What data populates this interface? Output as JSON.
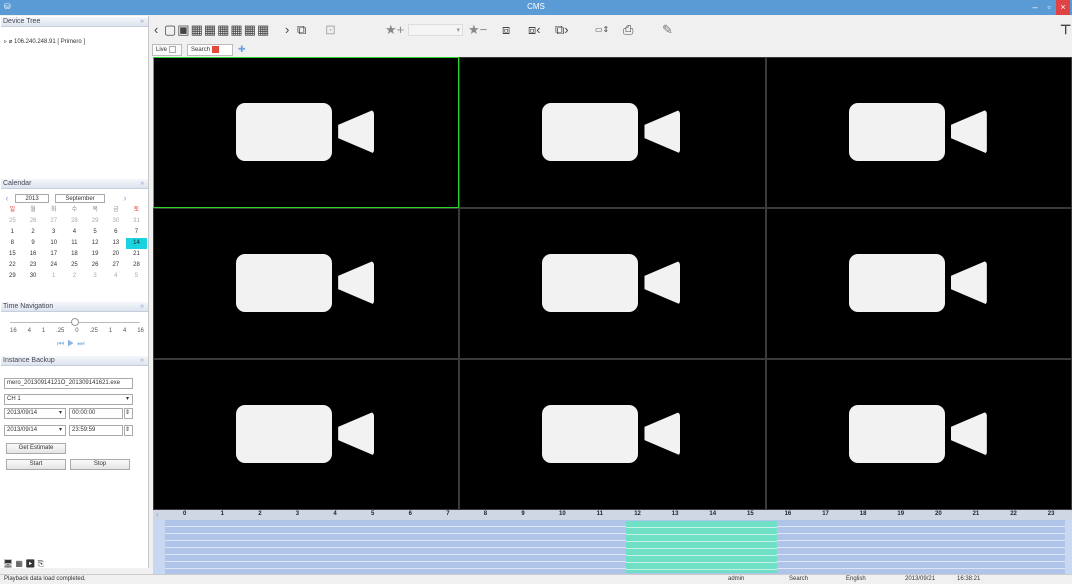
{
  "window": {
    "title": "CMS"
  },
  "device_tree": {
    "header": "Device Tree",
    "items": [
      {
        "label": "106.240.248.91 [ Primero ]"
      }
    ],
    "tools": {
      "add": "add-device-icon",
      "remove": "remove-device-icon",
      "edit": "edit-device-icon"
    }
  },
  "calendar": {
    "header": "Calendar",
    "year": "2013",
    "month": "September",
    "weekdays": [
      "일",
      "월",
      "화",
      "수",
      "목",
      "금",
      "토"
    ],
    "weeks": [
      [
        "25",
        "26",
        "27",
        "28",
        "29",
        "30",
        "31"
      ],
      [
        "1",
        "2",
        "3",
        "4",
        "5",
        "6",
        "7"
      ],
      [
        "8",
        "9",
        "10",
        "11",
        "12",
        "13",
        "14"
      ],
      [
        "15",
        "16",
        "17",
        "18",
        "19",
        "20",
        "21"
      ],
      [
        "22",
        "23",
        "24",
        "25",
        "26",
        "27",
        "28"
      ],
      [
        "29",
        "30",
        "1",
        "2",
        "3",
        "4",
        "5"
      ]
    ],
    "selected": "14"
  },
  "time_navigation": {
    "header": "Time Navigation",
    "labels": [
      "16",
      "4",
      "1",
      ".25",
      "0",
      ".25",
      "1",
      "4",
      "16"
    ],
    "slider_position": 0.5
  },
  "instance_backup": {
    "header": "Instance Backup",
    "filename": "mero_20130914121O_201309141621.exe",
    "channel": "CH 1",
    "start_date": "2013/09/14",
    "start_time": "00:00:00",
    "end_date": "2013/09/14",
    "end_time": "23:59:59",
    "estimate_label": "Get Estimate",
    "start_label": "Start",
    "stop_label": "Stop"
  },
  "tabs": [
    {
      "label": "Live"
    },
    {
      "label": "Search"
    }
  ],
  "timeline": {
    "hours": [
      "0",
      "1",
      "2",
      "3",
      "4",
      "5",
      "6",
      "7",
      "8",
      "9",
      "10",
      "11",
      "12",
      "13",
      "14",
      "15",
      "16",
      "17",
      "18",
      "19",
      "20",
      "21",
      "22",
      "23"
    ],
    "recorded_start_hour": 12,
    "recorded_end_hour": 16
  },
  "status": {
    "message": "Playback data load completed.",
    "user": "admin",
    "mode": "Search",
    "language": "English",
    "date": "2013/09/21",
    "time": "16:38:21"
  },
  "colors": {
    "accent": "#5b9bd5",
    "selected_cell": "#2bd32b",
    "calendar_selected": "#19d3e0",
    "recorded": "#6fe0c6"
  }
}
